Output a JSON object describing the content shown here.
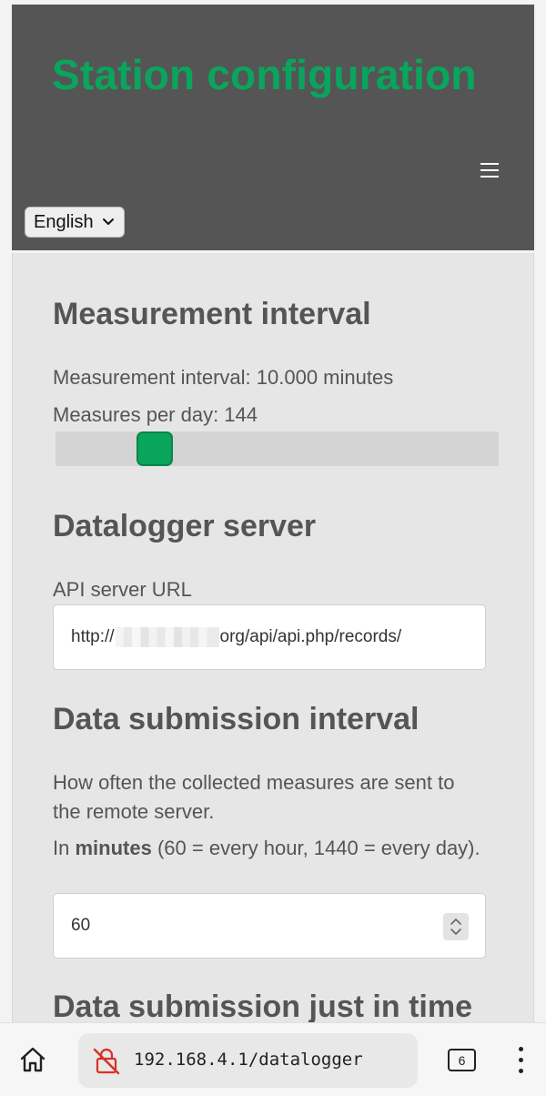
{
  "header": {
    "title": "Station configuration",
    "menu_icon": "hamburger-menu-icon",
    "language_select": {
      "selected": "English"
    }
  },
  "measurement": {
    "title": "Measurement interval",
    "interval_text": "Measurement interval: 10.000 minutes",
    "per_day_text": "Measures per day: 144"
  },
  "datalogger": {
    "title": "Datalogger server",
    "api_label": "API server URL",
    "api_url_prefix": "http://",
    "api_url_suffix": "org/api/api.php/records/"
  },
  "submission": {
    "title": "Data submission interval",
    "description": "How often the collected measures are sent to the remote server.",
    "unit_prefix": "In",
    "unit_bold": "minutes",
    "unit_suffix": "(60 = every hour, 1440 = every day).",
    "value": "60"
  },
  "just_in_time": {
    "title": "Data submission just in time"
  },
  "browser": {
    "url": "192.168.4.1/datalogger",
    "tab_count": "6",
    "home_icon": "home-icon",
    "security_icon": "not-secure-icon",
    "more_icon": "more-vertical-icon"
  },
  "colors": {
    "accent": "#0aa55c",
    "header_bg": "#555555",
    "panel_bg": "#e6e6e6",
    "text": "#555555"
  }
}
